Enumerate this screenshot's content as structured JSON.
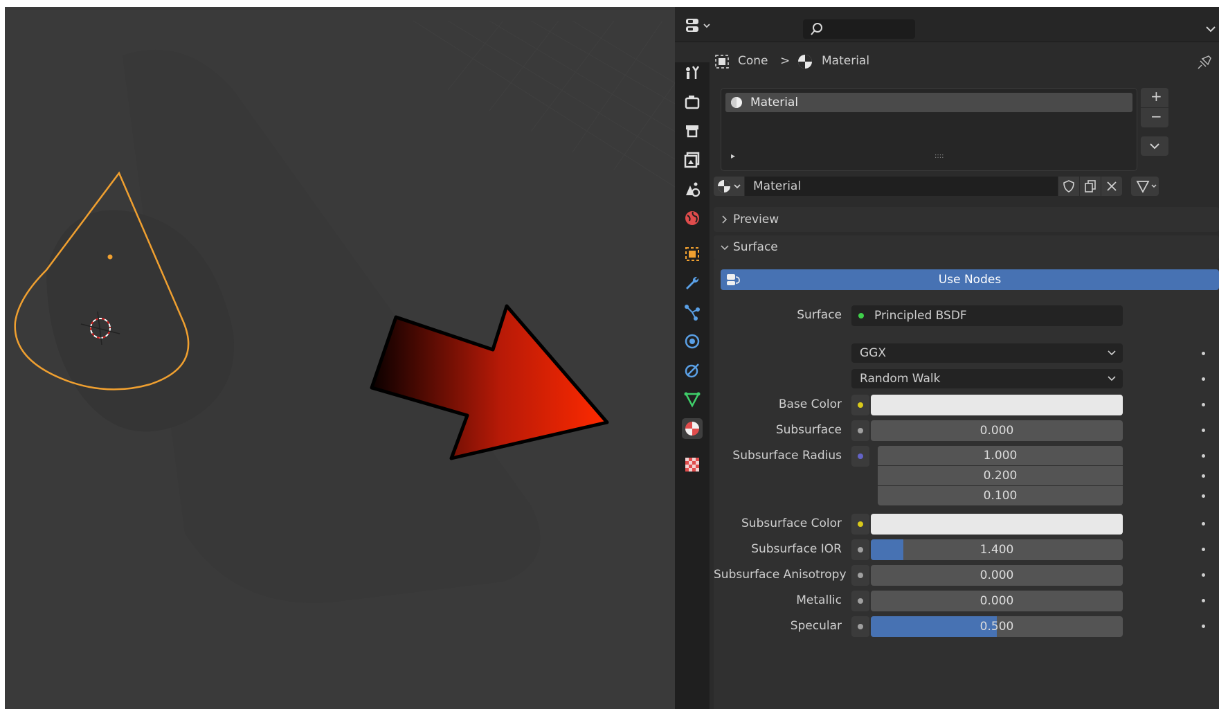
{
  "header": {
    "breadcrumb_object": "Cone",
    "breadcrumb_material": "Material",
    "breadcrumb_sep": ">"
  },
  "material_slots": {
    "slot_name": "Material",
    "expand_glyph": "▸",
    "grip": "::::"
  },
  "datablock": {
    "material_name": "Material",
    "add_slot": "+",
    "remove_slot": "−"
  },
  "panels": {
    "preview_label": "Preview",
    "surface_label": "Surface"
  },
  "surface": {
    "use_nodes_label": "Use Nodes",
    "surface_label": "Surface",
    "shader_name": "Principled BSDF",
    "distribution": "GGX",
    "subsurface_method": "Random Walk",
    "properties": [
      {
        "label": "Base Color",
        "value": "",
        "socket": "#d9c91a"
      },
      {
        "label": "Subsurface",
        "value": "0.000",
        "socket": "#a0a0a0"
      },
      {
        "label": "Subsurface Radius",
        "value": "1.000",
        "socket": "#6363c7"
      },
      {
        "label": "",
        "value": "0.200",
        "socket": ""
      },
      {
        "label": "",
        "value": "0.100",
        "socket": ""
      },
      {
        "label": "Subsurface Color",
        "value": "",
        "socket": "#d9c91a"
      },
      {
        "label": "Subsurface IOR",
        "value": "1.400",
        "socket": "#a0a0a0"
      },
      {
        "label": "Subsurface Anisotropy",
        "value": "0.000",
        "socket": "#a0a0a0"
      },
      {
        "label": "Metallic",
        "value": "0.000",
        "socket": "#a0a0a0"
      },
      {
        "label": "Specular",
        "value": "0.500",
        "socket": "#a0a0a0"
      }
    ]
  },
  "sliders": {
    "subsurface_ior_fill_fraction": 0.13,
    "specular_fill_fraction": 0.5
  },
  "colors": {
    "accent_blue": "#4772b3",
    "selection_orange": "#f0a030",
    "arrow_red": "#e62008",
    "active_tab_red": "#e04c4c"
  },
  "icons": {
    "sidebar_tabs": [
      "tool-icon",
      "render-icon",
      "output-icon",
      "view-layer-icon",
      "scene-icon",
      "world-icon",
      "object-icon",
      "modifier-icon",
      "particles-icon",
      "physics-icon",
      "constraints-icon",
      "data-icon",
      "material-icon",
      "texture-icon"
    ]
  }
}
